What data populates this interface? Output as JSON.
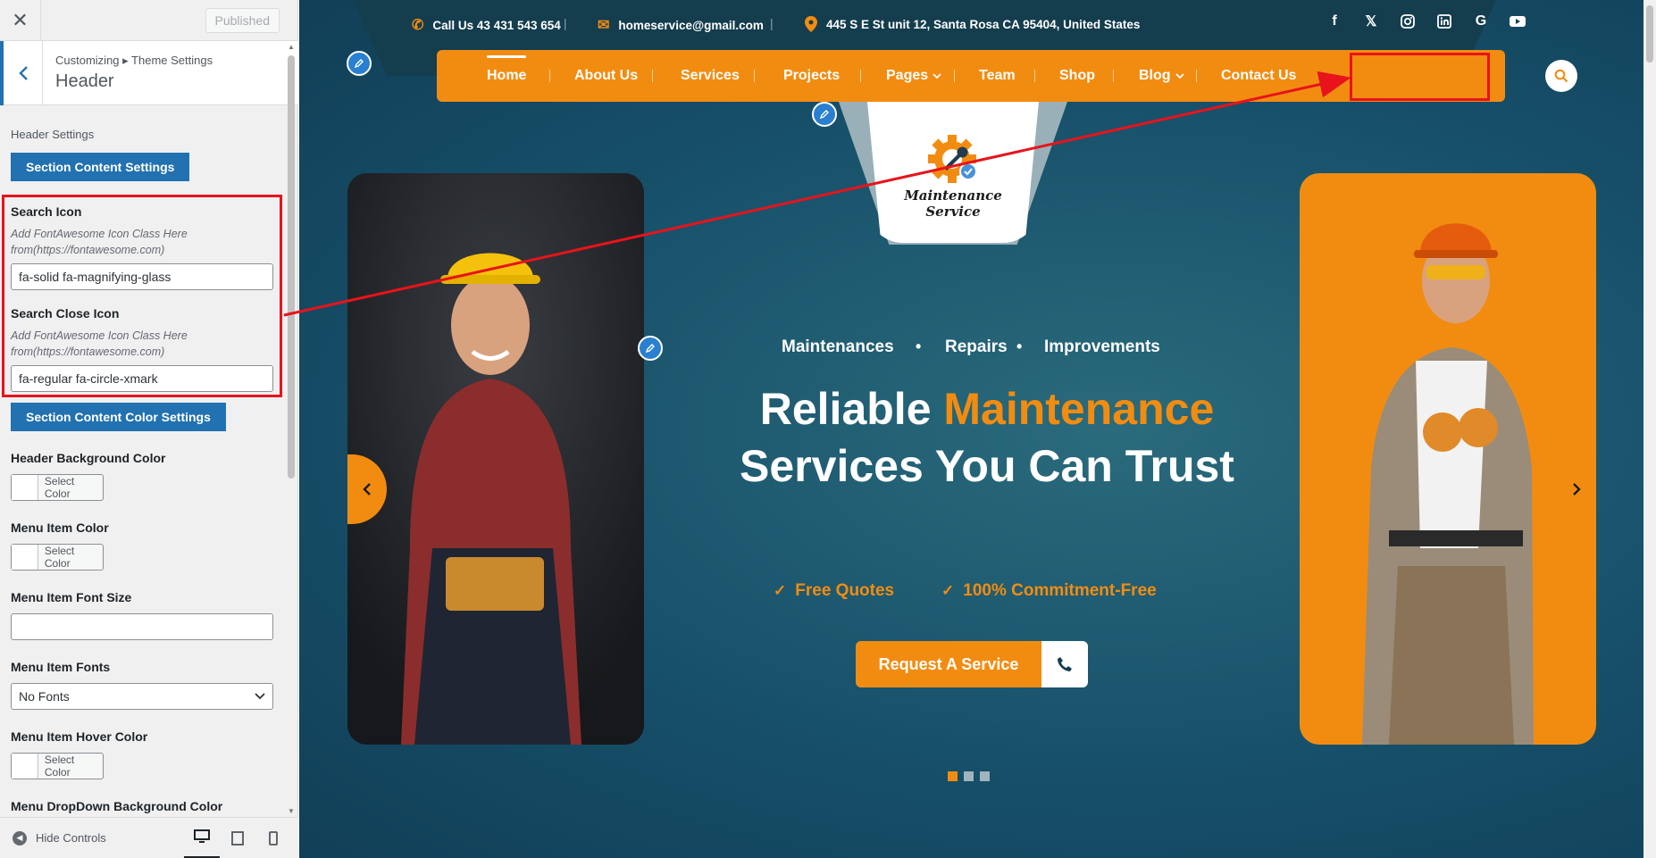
{
  "sidebar": {
    "close_label": "✕",
    "published_label": "Published",
    "breadcrumb": "Customizing ▸ Theme Settings",
    "panel_title": "Header",
    "header_settings_label": "Header Settings",
    "section_content_btn": "Section Content Settings",
    "search_icon_title": "Search Icon",
    "search_icon_desc": "Add FontAwesome Icon Class Here from(https://fontawesome.com)",
    "search_icon_value": "fa-solid fa-magnifying-glass",
    "search_close_title": "Search Close Icon",
    "search_close_desc": "Add FontAwesome Icon Class Here from(https://fontawesome.com)",
    "search_close_value": "fa-regular fa-circle-xmark",
    "section_color_btn": "Section Content Color Settings",
    "header_bg_title": "Header Background Color",
    "menu_item_color_title": "Menu Item Color",
    "menu_font_size_title": "Menu Item Font Size",
    "menu_fonts_title": "Menu Item Fonts",
    "menu_fonts_value": "No Fonts",
    "menu_hover_title": "Menu Item Hover Color",
    "menu_dropdown_bg_title": "Menu DropDown Background Color",
    "select_color_label": "Select Color",
    "hide_controls_label": "Hide Controls"
  },
  "preview": {
    "contact": {
      "phone": "Call Us 43 431 543 654",
      "email": "homeservice@gmail.com",
      "address": "445 S E St unit 12, Santa Rosa CA 95404, United States"
    },
    "socials": [
      "facebook-icon",
      "x-twitter-icon",
      "instagram-icon",
      "linkedin-icon",
      "google-icon",
      "youtube-icon"
    ],
    "nav": {
      "home": "Home",
      "about": "About Us",
      "services": "Services",
      "projects": "Projects",
      "pages": "Pages",
      "team": "Team",
      "shop": "Shop",
      "blog": "Blog",
      "contact": "Contact Us"
    },
    "logo": {
      "line1": "Maintenance",
      "line2": "Service"
    },
    "hero": {
      "tag1": "Maintenances",
      "tag2": "Repairs",
      "tag3": "Improvements",
      "heading_part1": "Reliable ",
      "heading_accent": "Maintenance",
      "heading_part2": "Services You Can Trust",
      "feature1": "Free Quotes",
      "feature2": "100% Commitment-Free",
      "cta": "Request A Service"
    },
    "slider_dots": 3,
    "colors": {
      "accent": "#f28c11",
      "nav_bg": "#f28c11",
      "topbar_bg": "#143d4e",
      "hero_bg": "#1f5a6b",
      "wp_blue": "#2271b1",
      "annotation": "#e8131b"
    }
  }
}
